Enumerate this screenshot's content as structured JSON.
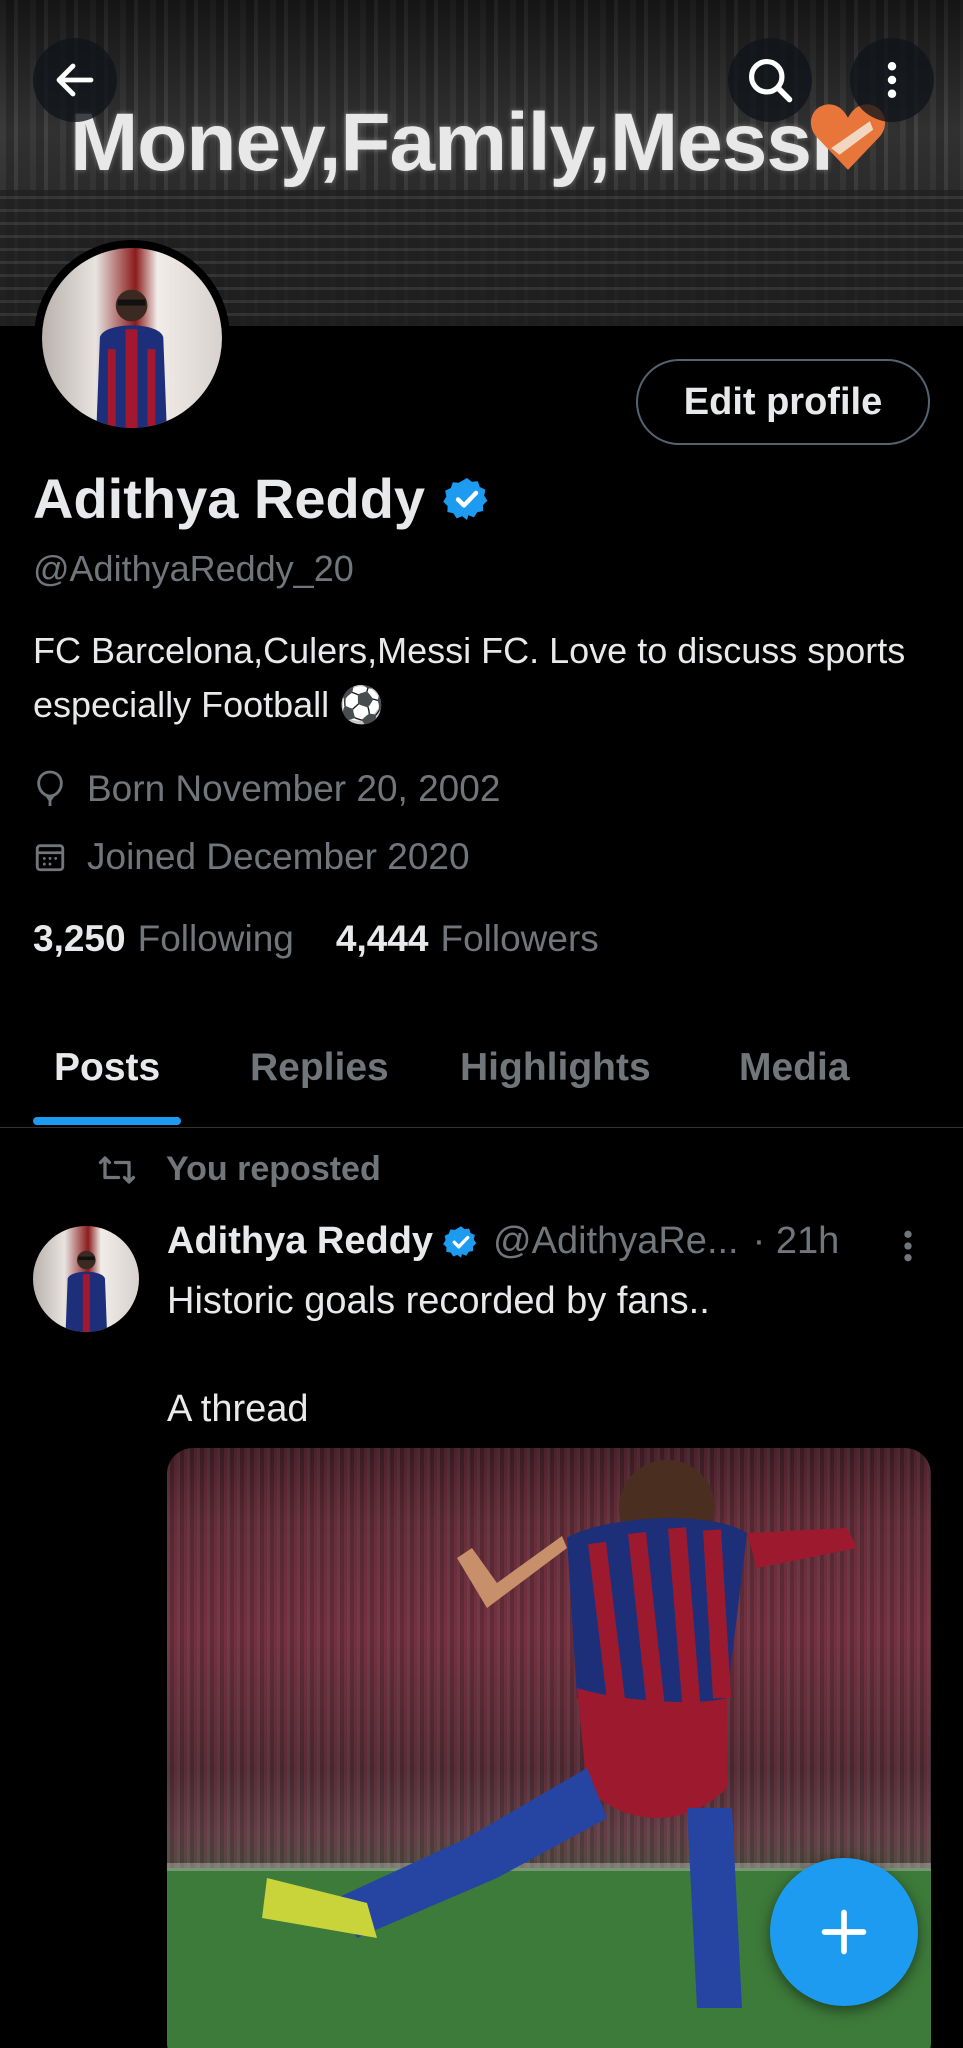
{
  "banner": {
    "text": "Money,Family,Messi"
  },
  "header": {
    "back_label": "Back",
    "search_label": "Search",
    "more_label": "More options"
  },
  "profile": {
    "edit_button": "Edit profile",
    "name": "Adithya Reddy",
    "handle": "@AdithyaReddy_20",
    "bio": "FC Barcelona,Culers,Messi FC. Love to discuss sports especially Football ⚽",
    "born": "Born November 20, 2002",
    "joined": "Joined December 2020",
    "following_count": "3,250",
    "following_label": "Following",
    "followers_count": "4,444",
    "followers_label": "Followers"
  },
  "tabs": [
    {
      "label": "Posts",
      "active": true
    },
    {
      "label": "Replies",
      "active": false
    },
    {
      "label": "Highlights",
      "active": false
    },
    {
      "label": "Media",
      "active": false
    }
  ],
  "post": {
    "repost_label": "You reposted",
    "author_name": "Adithya Reddy",
    "author_handle": "@AdithyaRe...",
    "time": "· 21h",
    "text": "Historic goals recorded by fans..\n\nA thread"
  },
  "colors": {
    "accent": "#1d9bf0",
    "background": "#000000",
    "secondary_text": "#71767b",
    "primary_text": "#e7e9ea"
  },
  "icons": [
    "back-arrow-icon",
    "search-icon",
    "more-vertical-icon",
    "verified-badge-icon",
    "balloon-icon",
    "calendar-icon",
    "repost-icon",
    "compose-plus-icon"
  ]
}
